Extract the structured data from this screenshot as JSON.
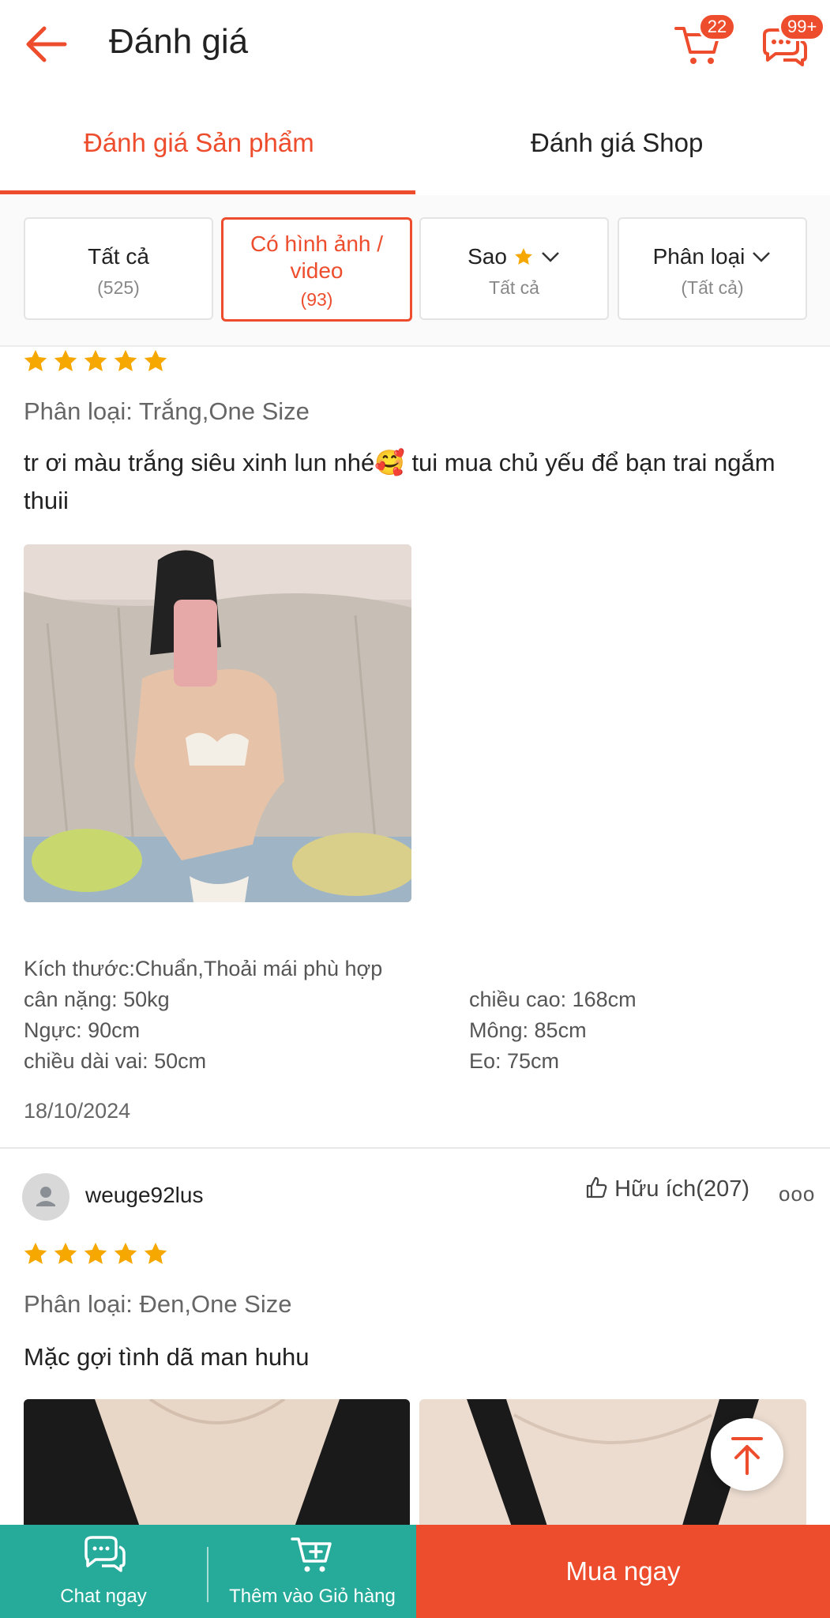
{
  "header": {
    "title": "Đánh giá",
    "cart_badge": "22",
    "chat_badge": "99+",
    "icons": [
      "back-arrow-icon",
      "cart-icon",
      "chat-icon"
    ],
    "accent": "#ee4d2d"
  },
  "tabs": [
    {
      "label": "Đánh giá Sản phẩm",
      "active": true
    },
    {
      "label": "Đánh giá Shop",
      "active": false
    }
  ],
  "filters": [
    {
      "label": "Tất cả",
      "sub": "(525)",
      "active": false
    },
    {
      "label": "Có hình ảnh / video",
      "sub": "(93)",
      "active": true
    },
    {
      "label": "Sao",
      "sub": "Tất cả",
      "active": false
    },
    {
      "label": "Phân loại",
      "sub": "(Tất cả)",
      "active": false
    }
  ],
  "reviews": [
    {
      "rating": 5,
      "variant": "Phân loại: Trắng,One Size",
      "comment": "tr ơi màu trắng siêu xinh lun nhé🥰 tui mua chủ yếu để bạn trai ngắm thuii",
      "details": {
        "fit": "Kích thước:Chuẩn,Thoải mái phù hợp",
        "weight": "cân nặng: 50kg",
        "height": "chiều cao: 168cm",
        "bust": "Ngực: 90cm",
        "hips": "Mông: 85cm",
        "shoulder": "chiều dài vai: 50cm",
        "waist": "Eo: 75cm"
      },
      "date": "18/10/2024"
    },
    {
      "username": "weuge92lus",
      "helpful_label": "Hữu ích",
      "helpful_count": "(207)",
      "more": "ooo",
      "rating": 5,
      "variant": "Phân loại: Đen,One Size",
      "comment": "Mặc gợi tình dã man huhu"
    }
  ],
  "bottom_bar": {
    "chat": "Chat ngay",
    "add_cart": "Thêm vào Giỏ hàng",
    "buy": "Mua ngay",
    "chat_color": "#26aa99",
    "buy_color": "#ee4d2d"
  }
}
